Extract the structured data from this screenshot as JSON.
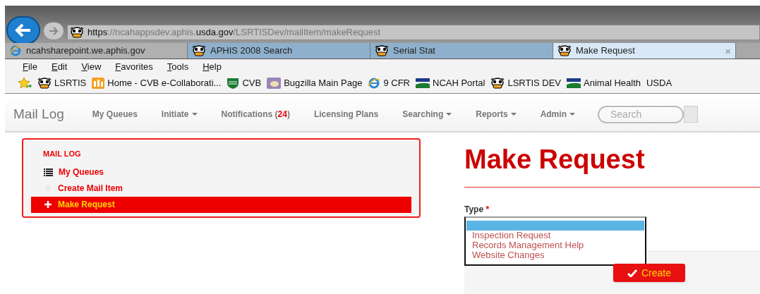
{
  "browser": {
    "address": {
      "scheme": "https",
      "host_start": "://ncahappsdev.aphis.",
      "host_domain": "usda.gov",
      "path": "/LSRTISDev/mailItem/makeRequest"
    },
    "tabs": [
      {
        "label": "ncahsharepoint.we.aphis.gov",
        "kind": "ie",
        "selected": false
      },
      {
        "label": "APHIS 2008 Search",
        "kind": "cow",
        "selected": false
      },
      {
        "label": "Serial Stat",
        "kind": "cow",
        "selected": false
      },
      {
        "label": "Make Request",
        "kind": "cow",
        "selected": true,
        "close": "×"
      }
    ],
    "menu": [
      "File",
      "Edit",
      "View",
      "Favorites",
      "Tools",
      "Help"
    ],
    "favorites": [
      {
        "label": "LSRTIS",
        "kind": "cow"
      },
      {
        "label": "Home - CVB e-Collaborati...",
        "kind": "grid"
      },
      {
        "label": "CVB",
        "kind": "aphis"
      },
      {
        "label": "Bugzilla Main Page",
        "kind": "bug"
      },
      {
        "label": "9 CFR",
        "kind": "ie"
      },
      {
        "label": "NCAH Portal",
        "kind": "usda"
      },
      {
        "label": "LSRTIS DEV",
        "kind": "cow"
      },
      {
        "label": "Animal Health",
        "kind": "usda"
      },
      {
        "label": "USDA",
        "kind": "text"
      }
    ]
  },
  "navbar": {
    "brand": "Mail Log",
    "items": [
      {
        "label": "My Queues",
        "dropdown": false
      },
      {
        "label": "Initiate",
        "dropdown": true
      },
      {
        "label": "Notifications (",
        "count": "24",
        "after": ")",
        "dropdown": false
      },
      {
        "label": "Licensing Plans",
        "dropdown": false
      },
      {
        "label": "Searching",
        "dropdown": true
      },
      {
        "label": "Reports",
        "dropdown": true
      },
      {
        "label": "Admin",
        "dropdown": true
      }
    ],
    "search": {
      "placeholder": "Search"
    }
  },
  "sidebar": {
    "heading": "MAIL LOG",
    "items": [
      {
        "label": "My Queues",
        "kind": "list",
        "selected": false
      },
      {
        "label": "Create Mail Item",
        "kind": "plus-faint",
        "selected": false
      },
      {
        "label": "Make Request",
        "kind": "plus",
        "selected": true
      }
    ]
  },
  "form": {
    "title": "Make Request",
    "type_label": "Type",
    "required_mark": "*",
    "blank_option_highlighted": true,
    "options": [
      "Inspection Request",
      "Records Management Help",
      "Website Changes"
    ],
    "submit": "Create"
  }
}
